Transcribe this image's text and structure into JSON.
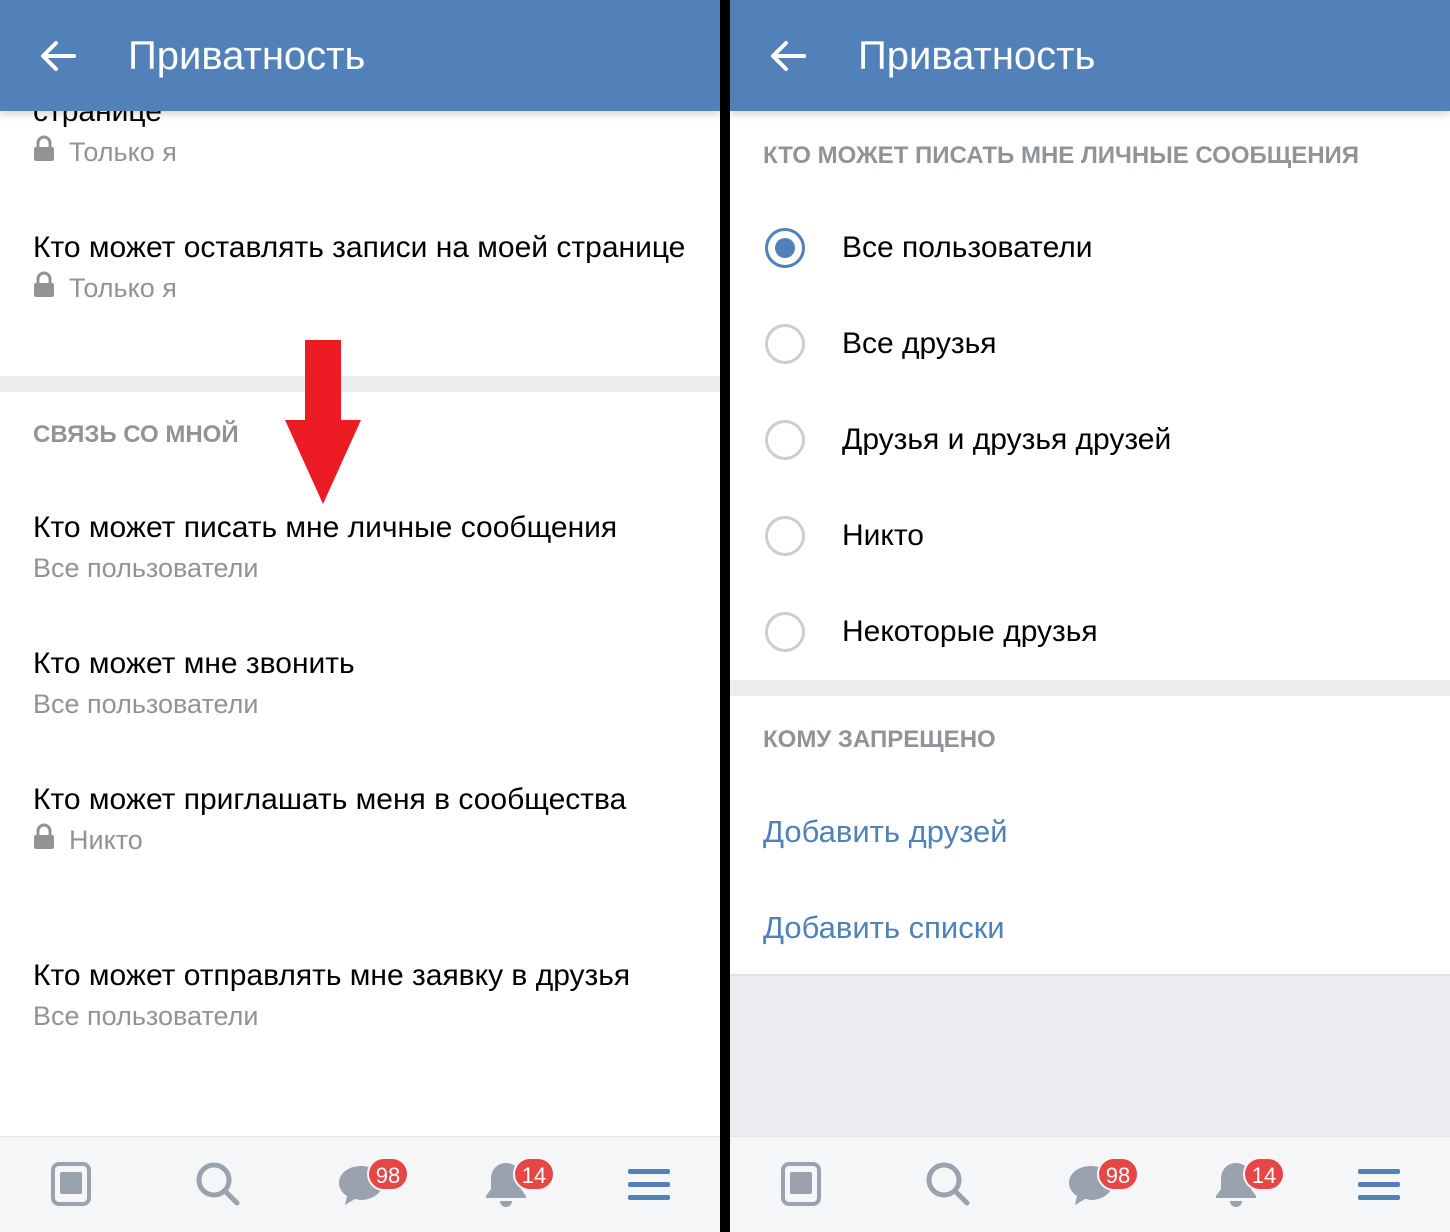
{
  "left": {
    "header": {
      "title": "Приватность"
    },
    "top_partial": {
      "title_fragment": "странице",
      "subtitle": "Только я"
    },
    "items_before": [
      {
        "title": "Кто может оставлять записи на моей странице",
        "subtitle": "Только я"
      }
    ],
    "section_header": "СВЯЗЬ СО МНОЙ",
    "items": [
      {
        "title": "Кто может писать мне личные сообщения",
        "subtitle": "Все пользователи"
      },
      {
        "title": "Кто может мне звонить",
        "subtitle": "Все пользователи"
      },
      {
        "title": "Кто может приглашать меня в сообщества",
        "subtitle": "Никто"
      },
      {
        "title": "Кто может отправлять мне заявку в друзья",
        "subtitle": "Все пользователи"
      }
    ],
    "annotation_arrow_color": "#ed1c24"
  },
  "right": {
    "header": {
      "title": "Приватность"
    },
    "section_header": "КТО МОЖЕТ ПИСАТЬ МНЕ ЛИЧНЫЕ СООБЩЕНИЯ",
    "options": [
      {
        "label": "Все пользователи",
        "selected": true
      },
      {
        "label": "Все друзья",
        "selected": false
      },
      {
        "label": "Друзья и друзья друзей",
        "selected": false
      },
      {
        "label": "Никто",
        "selected": false
      },
      {
        "label": "Некоторые друзья",
        "selected": false
      }
    ],
    "forbidden_header": "КОМУ ЗАПРЕЩЕНО",
    "links": [
      "Добавить друзей",
      "Добавить списки"
    ]
  },
  "tabbar": {
    "icons": [
      "news-icon",
      "search-icon",
      "messages-icon",
      "notifications-icon",
      "menu-icon"
    ],
    "messages_badge": "98",
    "notifications_badge": "14"
  },
  "colors": {
    "header": "#5181b8",
    "accent": "#5181b8",
    "badge": "#e64646",
    "subtitle": "#939393",
    "separator": "#ebedf0"
  }
}
